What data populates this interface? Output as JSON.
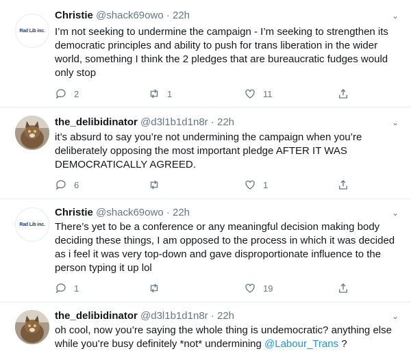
{
  "tweets": [
    {
      "display_name": "Christie",
      "handle": "@shack69owo",
      "dot": "·",
      "time": "22h",
      "avatar_text": "Rad Lib inc.",
      "text": "I’m not seeking to undermine the campaign - I’m seeking to strengthen its democratic principles and ability to push for trans liberation in the wider world, something I think the 2 pledges that are bureaucratic fudges would only stop",
      "replies": "2",
      "retweets": "1",
      "likes": "11"
    },
    {
      "display_name": "the_delibidinator",
      "handle": "@d3l1b1d1n8r",
      "dot": "·",
      "time": "22h",
      "text": "it’s absurd to say you’re not undermining the campaign when you’re deliberately opposing the most important pledge AFTER IT WAS DEMOCRATICALLY AGREED.",
      "replies": "6",
      "retweets": "",
      "likes": "1"
    },
    {
      "display_name": "Christie",
      "handle": "@shack69owo",
      "dot": "·",
      "time": "22h",
      "avatar_text": "Rad Lib inc.",
      "text": "There’s yet to be a conference or any meaningful decision making body deciding these things, I am opposed to the process in which it was decided as i feel it was very top-down and gave disproportionate influence to the person typing it up lol",
      "replies": "1",
      "retweets": "",
      "likes": "19"
    },
    {
      "display_name": "the_delibidinator",
      "handle": "@d3l1b1d1n8r",
      "dot": "·",
      "time": "22h",
      "text": "oh cool, now you’re saying the whole thing is undemocratic? anything else while you’re busy definitely *not* undermining ",
      "mention": "@Labour_Trans",
      "text_end": " ?"
    }
  ],
  "icons": {
    "reply": "reply-icon",
    "retweet": "retweet-icon",
    "like": "heart-icon",
    "share": "share-icon",
    "caret": "chevron-down-icon"
  },
  "colors": {
    "text": "#14171a",
    "secondary": "#657786",
    "link": "#1b95e0",
    "divider": "#e6ecf0"
  }
}
